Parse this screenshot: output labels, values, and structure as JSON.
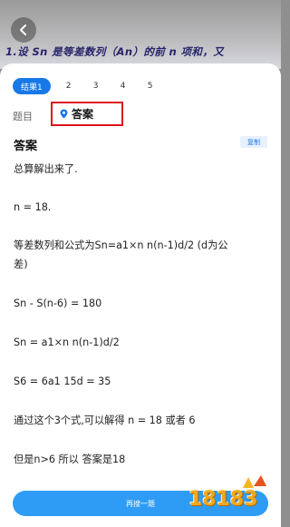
{
  "photo": {
    "question_text": "1.设 Sn 是等差数列（An）的前 n 项和，又"
  },
  "tabs": [
    "结果1",
    "2",
    "3",
    "4",
    "5"
  ],
  "subtabs": {
    "question": "题目",
    "answer": "答案"
  },
  "answer": {
    "title": "答案",
    "copy_label": "复制",
    "lines": [
      "总算解出来了.",
      "n = 18.",
      "等差数列和公式为Sn=a1×n n(n-1)d/2 (d为公",
      "差)",
      "Sn - S(n-6) = 180",
      "Sn = a1×n n(n-1)d/2",
      "S6 = 6a1 15d = 35",
      "通过这个3个式,可以解得 n = 18 或者 6",
      "但是n>6 所以 答案是18"
    ]
  },
  "search_again_label": "再搜一题",
  "watermark": "18183",
  "colors": {
    "accent": "#1778e8",
    "button": "#2e9cf4",
    "highlight_border": "#e0121c"
  },
  "icons": {
    "back": "chevron-left-icon",
    "answer_tab": "location-pin-icon"
  }
}
